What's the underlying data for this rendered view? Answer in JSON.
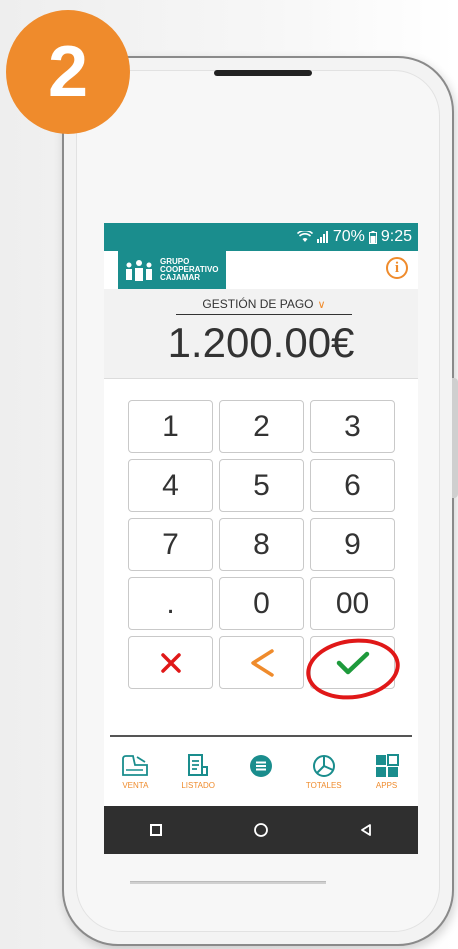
{
  "step": {
    "number": "2",
    "color": "#ef8b2c"
  },
  "statusbar": {
    "battery": "70%",
    "time": "9:25",
    "wifi_icon": "wifi-icon",
    "signal_icon": "signal-icon"
  },
  "appbar": {
    "logo_lines": [
      "GRUPO",
      "COOPERATIVO",
      "CAJAMAR"
    ],
    "info_label": "i"
  },
  "payment": {
    "mode": "GESTIÓN DE PAGO",
    "amount": "1.200.00€"
  },
  "keypad": {
    "keys": [
      "1",
      "2",
      "3",
      "4",
      "5",
      "6",
      "7",
      "8",
      "9",
      ".",
      "0",
      "00"
    ],
    "cancel_icon": "close-icon",
    "backspace_icon": "chevron-left-icon",
    "confirm_icon": "check-icon"
  },
  "nav": {
    "items": [
      {
        "label": "VENTA",
        "icon": "register-icon"
      },
      {
        "label": "LISTADO",
        "icon": "list-icon"
      },
      {
        "label": "",
        "icon": "menu-icon"
      },
      {
        "label": "TOTALES",
        "icon": "pie-chart-icon"
      },
      {
        "label": "APPS",
        "icon": "apps-icon"
      }
    ]
  },
  "colors": {
    "teal": "#1a8d8d",
    "orange": "#ef8b2c",
    "red": "#e01818",
    "green": "#1e9a3c"
  }
}
